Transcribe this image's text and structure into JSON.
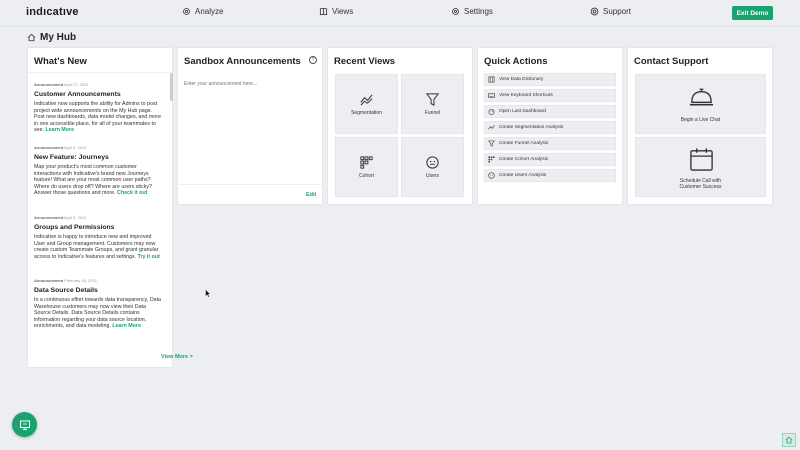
{
  "header": {
    "logo": "indıcatıve",
    "nav": [
      {
        "label": "Analyze",
        "icon": "gear-icon"
      },
      {
        "label": "Views",
        "icon": "book-icon"
      },
      {
        "label": "Settings",
        "icon": "gear-icon"
      },
      {
        "label": "Support",
        "icon": "support-icon"
      }
    ],
    "exit_demo": "Exit Demo"
  },
  "page": {
    "title": "My Hub",
    "icon": "home-icon"
  },
  "whats_new": {
    "title": "What's New",
    "items": [
      {
        "tag": "Announcement",
        "date": "April 27, 2021",
        "title": "Customer Announcements",
        "body": "Indicative now supports the ability for Admins to post project wide announcements on the My Hub page. Post new dashboards, data model changes, and more in one accessible place, for all of your teammates to see.",
        "link": "Learn More"
      },
      {
        "tag": "Announcement",
        "date": "April 6, 2021",
        "title": "New Feature: Journeys",
        "body": "Map your product's most common customer interactions with Indicative's brand new Journeys feature! What are your most common user paths? Where do users drop off? Where are users sticky? Answer those questions and more.",
        "link": "Check it out"
      },
      {
        "tag": "Announcement",
        "date": "April 5, 2021",
        "title": "Groups and Permissions",
        "body": "Indicative is happy to introduce new and improved User and Group management. Customers may now create custom Teammate Groups, and grant granular access to Indicative's features and settings.",
        "link": "Try it out"
      },
      {
        "tag": "Announcement",
        "date": "February 16, 2021",
        "title": "Data Source Details",
        "body": "In a continuous effort towards data transparency, Data Warehouse customers may now view their Data Source Details. Data Source Details contains information regarding your data source location, enrichments, and data modeling.",
        "link": "Learn More"
      }
    ],
    "view_more": "View More >"
  },
  "sandbox": {
    "title": "Sandbox Announcements",
    "placeholder": "Enter your announcement here...",
    "help": "?",
    "edit": "Edit"
  },
  "recent_views": {
    "title": "Recent Views",
    "tiles": [
      {
        "label": "Segmentation",
        "icon": "segmentation-icon"
      },
      {
        "label": "Funnel",
        "icon": "funnel-icon"
      },
      {
        "label": "Cohort",
        "icon": "cohort-icon"
      },
      {
        "label": "Users",
        "icon": "users-icon"
      }
    ]
  },
  "quick_actions": {
    "title": "Quick Actions",
    "items": [
      {
        "label": "View Data Dictionary",
        "icon": "dictionary-icon"
      },
      {
        "label": "View Keyboard Shortcuts",
        "icon": "keyboard-icon"
      },
      {
        "label": "Open Last Dashboard",
        "icon": "dashboard-icon"
      },
      {
        "label": "Create Segmentation Analysis",
        "icon": "segmentation-icon"
      },
      {
        "label": "Create Funnel Analysis",
        "icon": "funnel-icon"
      },
      {
        "label": "Create Cohort Analysis",
        "icon": "cohort-icon"
      },
      {
        "label": "Create Users Analysis",
        "icon": "users-icon"
      }
    ]
  },
  "contact_support": {
    "title": "Contact Support",
    "live_chat": "Begin a Live Chat",
    "schedule_line1": "Schedule Call with",
    "schedule_line2": "Customer Success"
  },
  "colors": {
    "accent": "#1aa36e",
    "background": "#eceef1",
    "panel": "#ffffff"
  }
}
